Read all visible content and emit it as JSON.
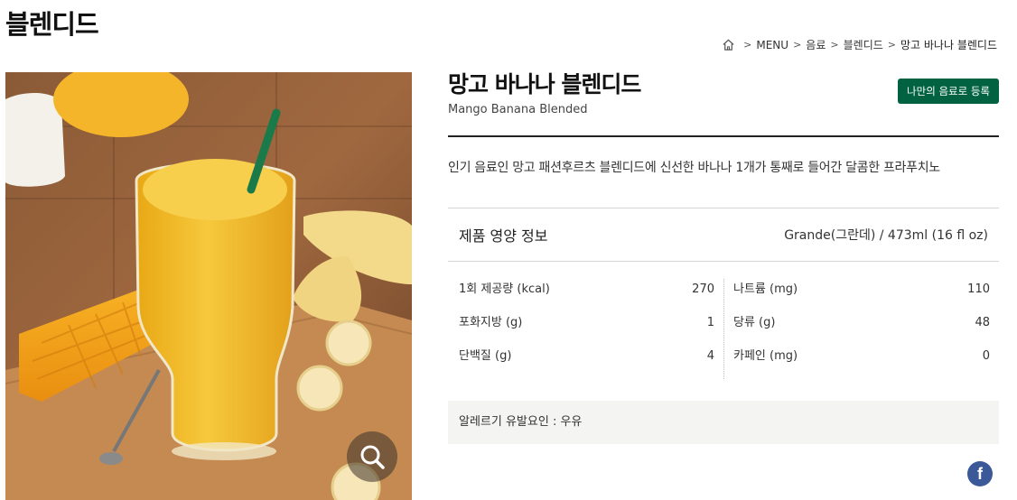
{
  "category": {
    "title": "블렌디드"
  },
  "breadcrumb": {
    "home_icon": "home-icon",
    "items": [
      "MENU",
      "음료",
      "블렌디드"
    ],
    "current": "망고 바나나 블렌디드"
  },
  "product": {
    "name_ko": "망고 바나나 블렌디드",
    "name_en": "Mango Banana Blended",
    "my_drink_label": "나만의 음료로 등록",
    "description": "인기 음료인 망고 패션후르츠 블렌디드에 신선한 바나나 1개가 통째로 들어간 달콤한 프라푸치노",
    "image_icon": "zoom-icon"
  },
  "nutrition": {
    "title": "제품 영양 정보",
    "size": "Grande(그란데) / 473ml (16 fl oz)",
    "left": [
      {
        "label": "1회 제공량 (kcal)",
        "value": "270"
      },
      {
        "label": "포화지방 (g)",
        "value": "1"
      },
      {
        "label": "단백질 (g)",
        "value": "4"
      }
    ],
    "right": [
      {
        "label": "나트륨 (mg)",
        "value": "110"
      },
      {
        "label": "당류 (g)",
        "value": "48"
      },
      {
        "label": "카페인 (mg)",
        "value": "0"
      }
    ],
    "allergy": "알레르기 유발요인 : 우유"
  },
  "share": {
    "facebook_icon": "facebook-icon",
    "facebook_letter": "f"
  },
  "colors": {
    "brand_green": "#006241",
    "facebook": "#3b5998"
  }
}
